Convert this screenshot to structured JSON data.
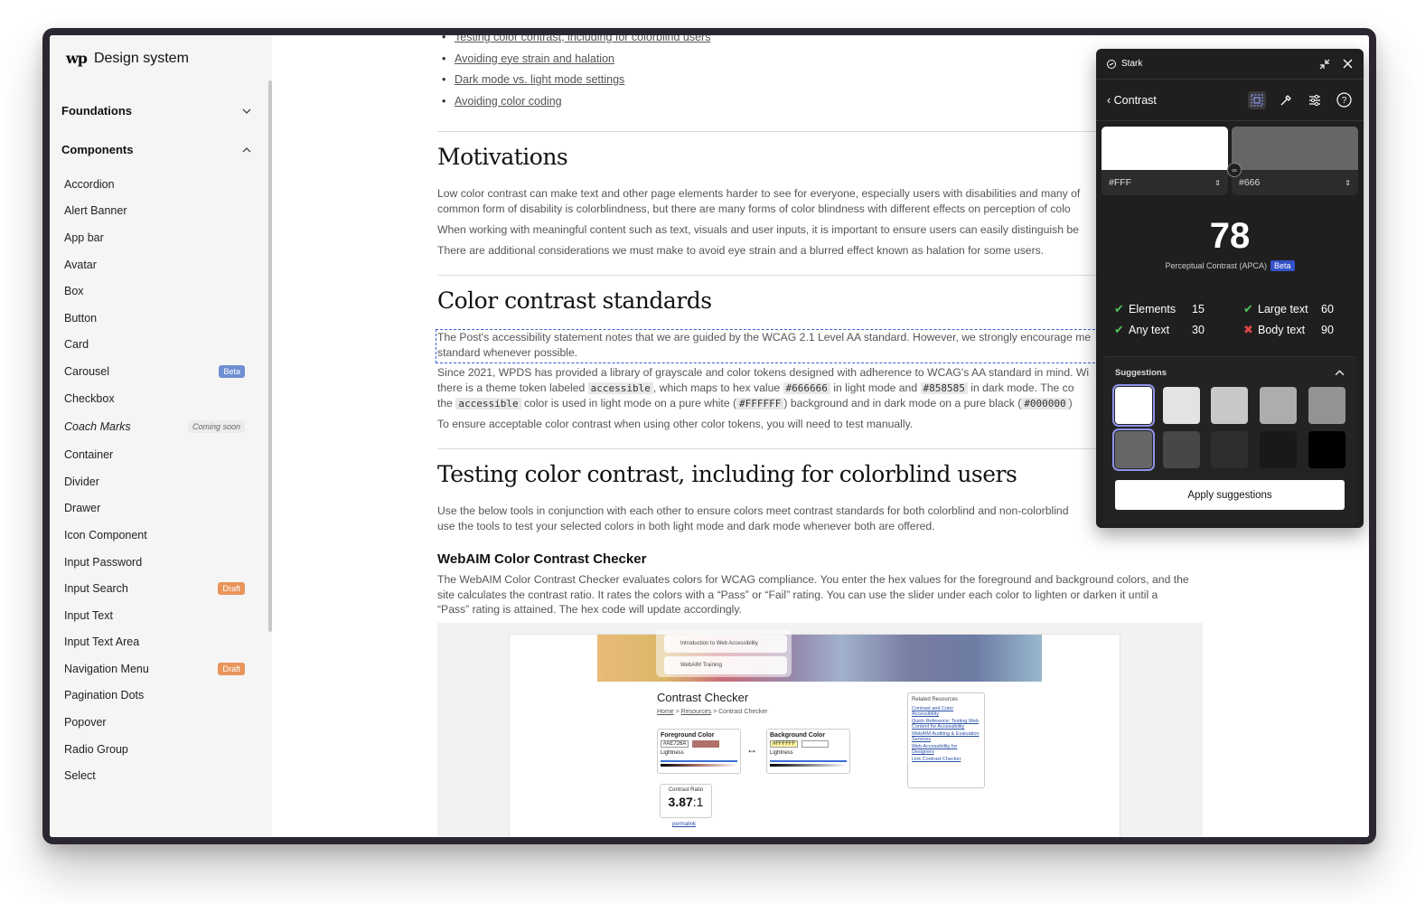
{
  "sidebar": {
    "logo_mark": "wp",
    "title": "Design system",
    "sections": [
      {
        "label": "Foundations",
        "state": "collapsed"
      },
      {
        "label": "Components",
        "state": "expanded"
      }
    ],
    "items": [
      {
        "label": "Accordion",
        "badge": ""
      },
      {
        "label": "Alert Banner",
        "badge": ""
      },
      {
        "label": "App bar",
        "badge": ""
      },
      {
        "label": "Avatar",
        "badge": ""
      },
      {
        "label": "Box",
        "badge": ""
      },
      {
        "label": "Button",
        "badge": ""
      },
      {
        "label": "Card",
        "badge": ""
      },
      {
        "label": "Carousel",
        "badge": "Beta"
      },
      {
        "label": "Checkbox",
        "badge": ""
      },
      {
        "label": "Coach Marks",
        "badge": "Coming soon"
      },
      {
        "label": "Container",
        "badge": ""
      },
      {
        "label": "Divider",
        "badge": ""
      },
      {
        "label": "Drawer",
        "badge": ""
      },
      {
        "label": "Icon Component",
        "badge": ""
      },
      {
        "label": "Input Password",
        "badge": ""
      },
      {
        "label": "Input Search",
        "badge": "Draft"
      },
      {
        "label": "Input Text",
        "badge": ""
      },
      {
        "label": "Input Text Area",
        "badge": ""
      },
      {
        "label": "Navigation Menu",
        "badge": "Draft"
      },
      {
        "label": "Pagination Dots",
        "badge": ""
      },
      {
        "label": "Popover",
        "badge": ""
      },
      {
        "label": "Radio Group",
        "badge": ""
      },
      {
        "label": "Select",
        "badge": ""
      }
    ]
  },
  "main": {
    "toc": [
      "Testing color contrast, including for colorblind users",
      "Avoiding eye strain and halation",
      "Dark mode vs. light mode settings",
      "Avoiding color coding"
    ],
    "motivations": {
      "heading": "Motivations",
      "p1": "Low color contrast can make text and other page elements harder to see for everyone, especially users with disabilities and many of",
      "p1b": "common form of disability is colorblindness, but there are many forms of color blindness with different effects on perception of colo",
      "p2": "When working with meaningful content such as text, visuals and user inputs, it is important to ensure users can easily distinguish be",
      "p3": "There are additional considerations we must make to avoid eye strain and a blurred effect known as halation for some users."
    },
    "standards": {
      "heading": "Color contrast standards",
      "p1_a": "The Post's ",
      "p1_link1": "accessibility statement",
      "p1_b": " notes that we are guided by the ",
      "p1_link2": "WCAG 2.1 Level AA standard",
      "p1_c": ". However, we strongly encourage me",
      "p1_link3": "standard",
      "p1_d": " whenever possible.",
      "p2_a": "Since 2021, WPDS has provided ",
      "p2_link": "a library of grayscale and color tokens",
      "p2_b": " designed with adherence to WCAG's AA standard in mind. Wi",
      "p2_c": "there is a theme token labeled ",
      "code1": "accessible",
      "p2_d": ", which maps to hex value ",
      "code2": "#666666",
      "p2_e": " in light mode and ",
      "code3": "#858585",
      "p2_f": " in dark mode. The co",
      "p2_g": "the ",
      "code4": "accessible",
      "p2_h": " color is used in light mode on a pure white (",
      "code5": "#FFFFFF",
      "p2_i": ") background and in dark mode on a pure black (",
      "code6": "#000000",
      "p2_j": ")",
      "p3": "To ensure acceptable color contrast when using other color tokens, you will need to test manually."
    },
    "testing": {
      "heading": "Testing color contrast, including for colorblind users",
      "p1": "Use the below tools in conjunction with each other to ensure colors meet contrast standards for both colorblind and non-colorblind",
      "p1b": "use the tools to test your selected colors in both light mode and dark mode whenever both are offered.",
      "sub": "WebAIM Color Contrast Checker",
      "p2_a": "The ",
      "p2_link": "WebAIM Color Contrast Checker",
      "p2_b": " evaluates colors for WCAG compliance. You enter the hex values for the foreground and background colors, and the",
      "p2_c": "site calculates the contrast ratio. It rates the colors with a “Pass” or “Fail” rating. You can use the slider under each color to lighten or darken it until a",
      "p2_d": "“Pass” rating is attained. The hex code will update accordingly."
    },
    "embed": {
      "pill1": "Introduction to Web Accessibility",
      "pill2": "WebAIM Training",
      "title": "Contrast Checker",
      "breadcrumb_home": "Home",
      "breadcrumb_sep1": " > ",
      "breadcrumb_resources": "Resources",
      "breadcrumb_rest": " > Contrast Checker",
      "fg_label": "Foreground Color",
      "fg_value": "#AE726A",
      "fg_color": "#AE726A",
      "bg_label": "Background Color",
      "bg_value": "#FFFFFF",
      "lightness": "Lightness",
      "swap": "↔",
      "ratio_label": "Contrast Ratio",
      "ratio_value": "3.87",
      "ratio_suffix": ":1",
      "permalink": "permalink",
      "related_title": "Related Resources",
      "related": [
        "Contrast and Color Accessibility",
        "Quick Reference: Testing Web Content for Accessibility",
        "WebAIM Auditing & Evaluation Services",
        "Web Accessibility for Designers",
        "Link Contrast Checker"
      ]
    }
  },
  "stark": {
    "app_name": "Stark",
    "back_label": "Contrast",
    "foreground": {
      "hex": "#FFF",
      "color": "#FFFFFF"
    },
    "background": {
      "hex": "#666",
      "color": "#666666"
    },
    "score": "78",
    "score_label": "Perceptual Contrast (APCA)",
    "score_badge": "Beta",
    "results": [
      {
        "label": "Elements",
        "value": "15",
        "pass": true
      },
      {
        "label": "Large text",
        "value": "60",
        "pass": true
      },
      {
        "label": "Any text",
        "value": "30",
        "pass": true
      },
      {
        "label": "Body text",
        "value": "90",
        "pass": false
      }
    ],
    "suggestions_title": "Suggestions",
    "suggestion_colors_row1": [
      "#FFFFFF",
      "#E3E3E3",
      "#C8C8C8",
      "#ADADAD",
      "#939393"
    ],
    "suggestion_colors_row2": [
      "#666666",
      "#474747",
      "#2E2E2E",
      "#191919",
      "#000000"
    ],
    "apply_label": "Apply suggestions"
  }
}
